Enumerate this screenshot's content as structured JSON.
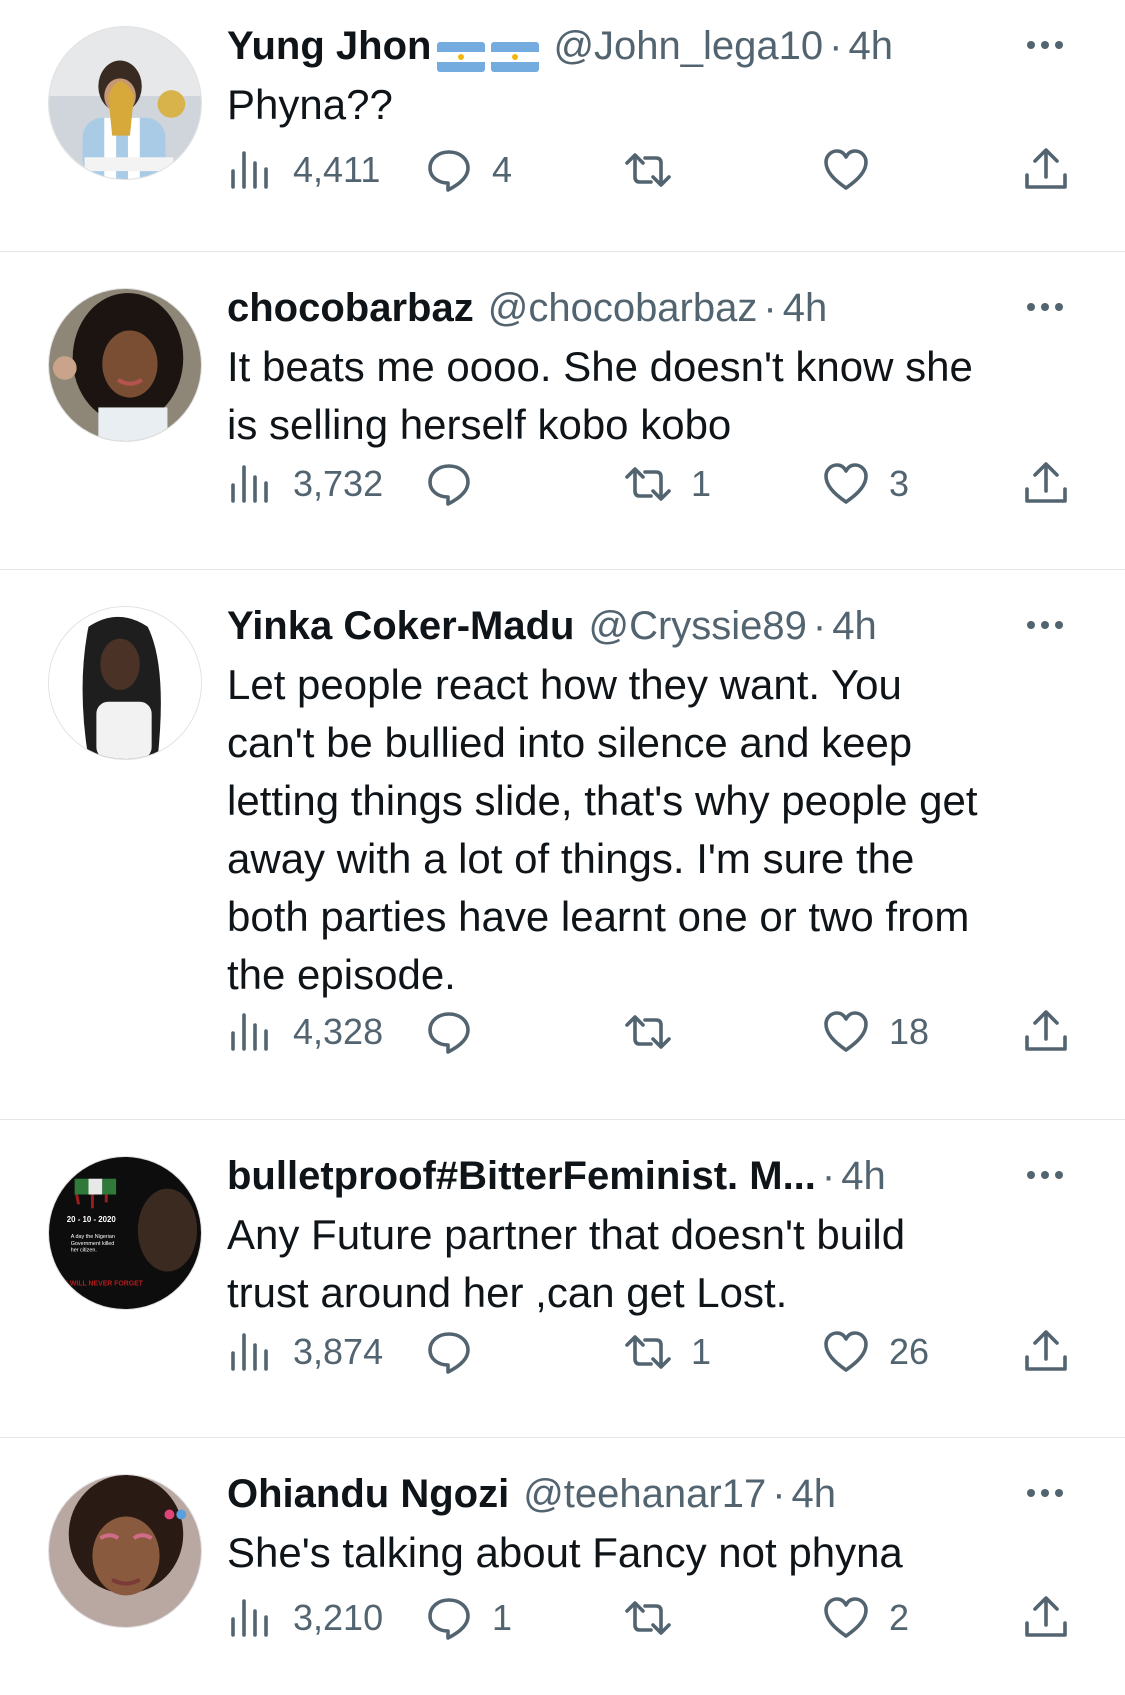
{
  "colors": {
    "text": "#0f1419",
    "secondary": "#536471",
    "divider": "#e6e6e6"
  },
  "tweets": [
    {
      "name": "Yung Jhon",
      "flags": [
        "argentina-flag",
        "argentina-flag"
      ],
      "handle": "@John_lega10",
      "time": "4h",
      "text": "Phyna??",
      "views": "4,411",
      "replies": "4",
      "retweets": "",
      "likes": ""
    },
    {
      "name": "chocobarbaz",
      "handle": "@chocobarbaz",
      "time": "4h",
      "text": "It beats me oooo. She doesn't know she\nis selling herself kobo kobo",
      "views": "3,732",
      "replies": "",
      "retweets": "1",
      "likes": "3"
    },
    {
      "name": "Yinka Coker-Madu",
      "handle": "@Cryssie89",
      "time": "4h",
      "text": "Let people react how they want. You\ncan't be bullied into silence and keep\nletting things slide, that's why people get\naway with a lot of things. I'm sure the\nboth parties have learnt one or two from\nthe episode.",
      "views": "4,328",
      "replies": "",
      "retweets": "",
      "likes": "18"
    },
    {
      "name": "bulletproof#BitterFeminist. M...",
      "handle": "",
      "time": "4h",
      "text": "Any Future partner that doesn't build\ntrust around her ,can get Lost.",
      "views": "3,874",
      "replies": "",
      "retweets": "1",
      "likes": "26",
      "avatar_text": [
        "20 - 10 - 2020",
        "A day the Nigerian",
        "Government killed",
        "her citizen.",
        "WE WILL NEVER FORGET"
      ]
    },
    {
      "name": "Ohiandu Ngozi",
      "handle": "@teehanar17",
      "time": "4h",
      "text": "She's talking about Fancy not phyna",
      "views": "3,210",
      "replies": "1",
      "retweets": "",
      "likes": "2"
    }
  ],
  "icons": {
    "views": "views-icon",
    "reply": "reply-icon",
    "retweet": "retweet-icon",
    "like": "heart-icon",
    "share": "share-icon",
    "more": "more-icon"
  }
}
